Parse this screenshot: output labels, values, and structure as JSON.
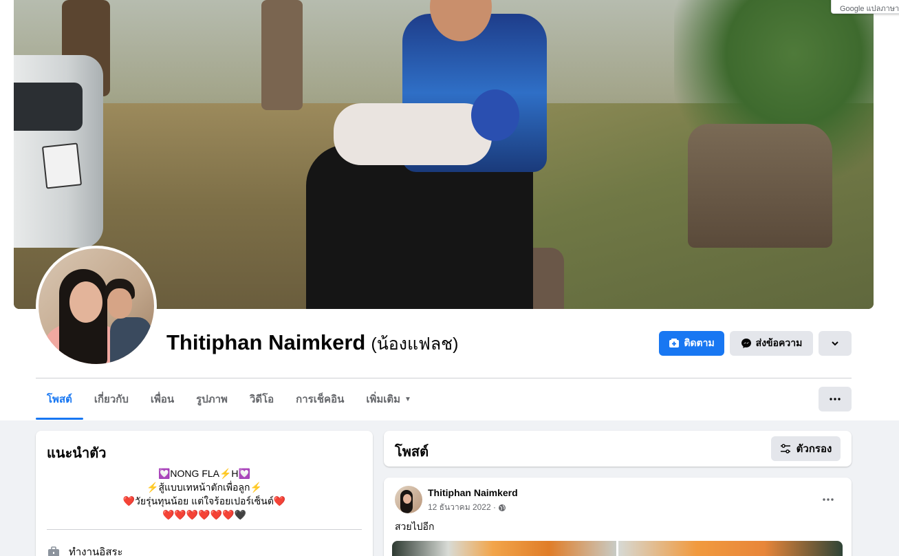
{
  "profile": {
    "name": "Thitiphan Naimkerd",
    "nickname": "(น้องแฟลช)"
  },
  "actions": {
    "follow_label": "ติดตาม",
    "message_label": "ส่งข้อความ"
  },
  "tabs": [
    {
      "label": "โพสต์",
      "active": true
    },
    {
      "label": "เกี่ยวกับ",
      "active": false
    },
    {
      "label": "เพื่อน",
      "active": false
    },
    {
      "label": "รูปภาพ",
      "active": false
    },
    {
      "label": "วิดีโอ",
      "active": false
    },
    {
      "label": "การเช็คอิน",
      "active": false
    },
    {
      "label": "เพิ่มเติม",
      "active": false
    }
  ],
  "intro": {
    "title": "แนะนำตัว",
    "bio_lines": [
      "💟NONG FLA⚡H💟",
      "⚡สู้แบบเทหน้าตักเพื่อลูก⚡",
      "❤️วัยรุ่นทุนน้อย แต่ใจร้อยเปอร์เซ็นต์❤️",
      "❤️❤️❤️❤️❤️❤️🖤"
    ],
    "work": "ทำงานอิสระ"
  },
  "posts": {
    "title": "โพสต์",
    "filter_label": "ตัวกรอง",
    "items": [
      {
        "author": "Thitiphan Naimkerd",
        "date": "12 ธันวาคม 2022 ·",
        "text": "สวยไปอีก"
      }
    ]
  },
  "overlay": {
    "google_tip": "Google แปลภาษา"
  },
  "colors": {
    "accent": "#1877f2",
    "background": "#f0f2f5",
    "secondary_button": "#e4e6eb"
  }
}
